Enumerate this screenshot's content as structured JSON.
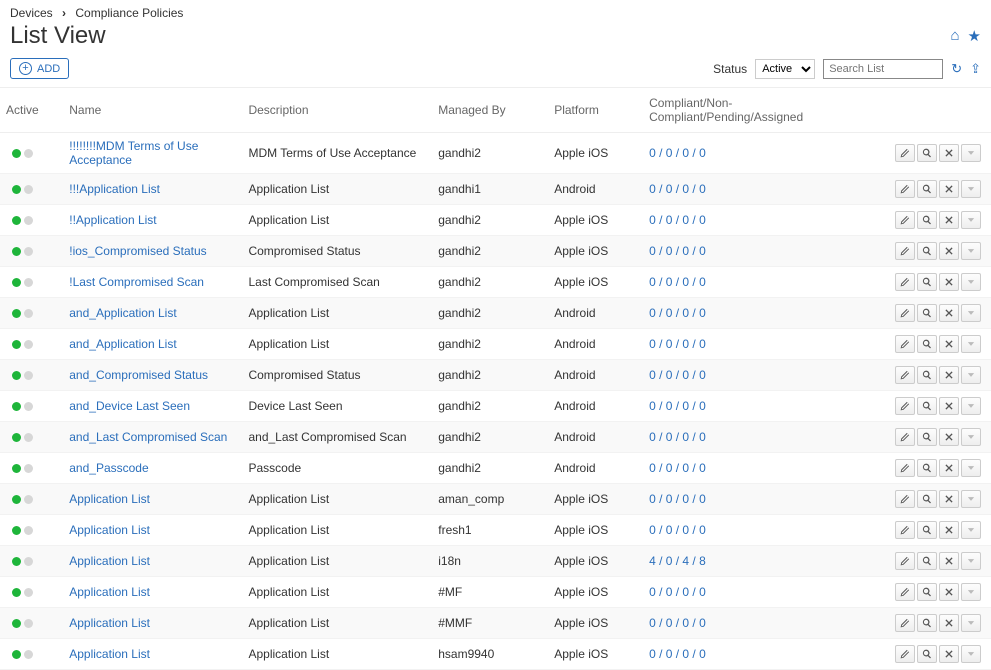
{
  "breadcrumb": {
    "root": "Devices",
    "current": "Compliance Policies"
  },
  "title": "List View",
  "toolbar": {
    "add_label": "ADD",
    "status_label": "Status",
    "status_value": "Active",
    "search_placeholder": "Search List"
  },
  "columns": {
    "active": "Active",
    "name": "Name",
    "description": "Description",
    "managed_by": "Managed By",
    "platform": "Platform",
    "compliance": "Compliant/Non-Compliant/Pending/Assigned"
  },
  "rows": [
    {
      "name": "!!!!!!!!MDM Terms of Use Acceptance",
      "description": "MDM Terms of Use Acceptance",
      "managed_by": "gandhi2",
      "platform": "Apple iOS",
      "compliance": "0 / 0 / 0 / 0"
    },
    {
      "name": "!!!Application List",
      "description": "Application List",
      "managed_by": "gandhi1",
      "platform": "Android",
      "compliance": "0 / 0 / 0 / 0"
    },
    {
      "name": "!!Application List",
      "description": "Application List",
      "managed_by": "gandhi2",
      "platform": "Apple iOS",
      "compliance": "0 / 0 / 0 / 0"
    },
    {
      "name": "!ios_Compromised Status",
      "description": "Compromised Status",
      "managed_by": "gandhi2",
      "platform": "Apple iOS",
      "compliance": "0 / 0 / 0 / 0"
    },
    {
      "name": "!Last Compromised Scan",
      "description": "Last Compromised Scan",
      "managed_by": "gandhi2",
      "platform": "Apple iOS",
      "compliance": "0 / 0 / 0 / 0"
    },
    {
      "name": "and_Application List",
      "description": "Application List",
      "managed_by": "gandhi2",
      "platform": "Android",
      "compliance": "0 / 0 / 0 / 0"
    },
    {
      "name": "and_Application List",
      "description": "Application List",
      "managed_by": "gandhi2",
      "platform": "Android",
      "compliance": "0 / 0 / 0 / 0"
    },
    {
      "name": "and_Compromised Status",
      "description": "Compromised Status",
      "managed_by": "gandhi2",
      "platform": "Android",
      "compliance": "0 / 0 / 0 / 0"
    },
    {
      "name": "and_Device Last Seen",
      "description": "Device Last Seen",
      "managed_by": "gandhi2",
      "platform": "Android",
      "compliance": "0 / 0 / 0 / 0"
    },
    {
      "name": "and_Last Compromised Scan",
      "description": "and_Last Compromised Scan",
      "managed_by": "gandhi2",
      "platform": "Android",
      "compliance": "0 / 0 / 0 / 0"
    },
    {
      "name": "and_Passcode",
      "description": "Passcode",
      "managed_by": "gandhi2",
      "platform": "Android",
      "compliance": "0 / 0 / 0 / 0"
    },
    {
      "name": "Application List",
      "description": "Application List",
      "managed_by": "aman_comp",
      "platform": "Apple iOS",
      "compliance": "0 / 0 / 0 / 0"
    },
    {
      "name": "Application List",
      "description": "Application List",
      "managed_by": "fresh1",
      "platform": "Apple iOS",
      "compliance": "0 / 0 / 0 / 0"
    },
    {
      "name": "Application List",
      "description": "Application List",
      "managed_by": "i18n",
      "platform": "Apple iOS",
      "compliance": "4 / 0 / 4 / 8"
    },
    {
      "name": "Application List",
      "description": "Application List",
      "managed_by": "#MF",
      "platform": "Apple iOS",
      "compliance": "0 / 0 / 0 / 0"
    },
    {
      "name": "Application List",
      "description": "Application List",
      "managed_by": "#MMF",
      "platform": "Apple iOS",
      "compliance": "0 / 0 / 0 / 0"
    },
    {
      "name": "Application List",
      "description": "Application List",
      "managed_by": "hsam9940",
      "platform": "Apple iOS",
      "compliance": "0 / 0 / 0 / 0"
    }
  ]
}
